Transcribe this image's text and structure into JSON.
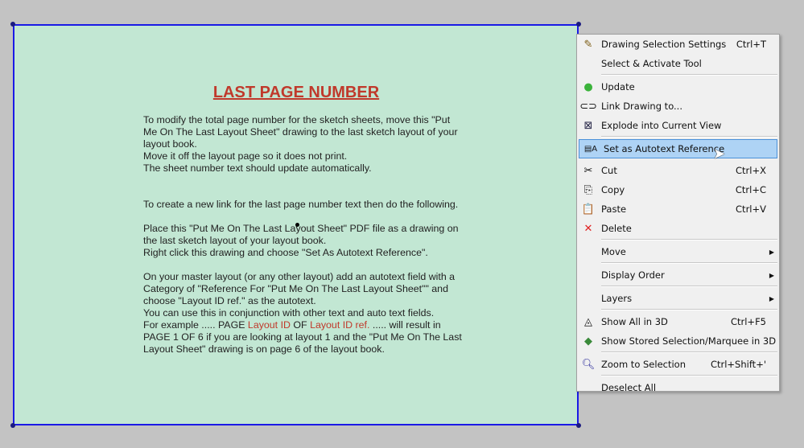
{
  "document": {
    "title": "LAST PAGE NUMBER",
    "paragraphs": [
      "To modify the total page number for the sketch sheets, move this \"Put Me On The Last Layout Sheet\" drawing to the last sketch layout of your layout book.\nMove it off the layout page so it does not print.\nThe sheet number text should update automatically.",
      "To create a new link for the last page number text then do the following.",
      "Place this \"Put Me On The Last Layout Sheet\" PDF file as a drawing on the last sketch layout of your layout book.\nRight click this drawing and choose \"Set As Autotext Reference\".",
      "On your master layout (or any other layout) add an autotext field with a Category of \"Reference For \"Put Me On The Last Layout Sheet\"\" and choose \"Layout ID ref.\" as the autotext.\nYou can use this in conjunction with other text and auto text fields."
    ],
    "example_parts": [
      "For example ..... PAGE ",
      "Layout ID",
      " OF ",
      "Layout ID ref.",
      " ..... will result in PAGE 1 OF 6 if you are looking at layout 1 and the \"Put Me On The Last Layout Sheet\" drawing is on page 6 of the layout book."
    ]
  },
  "context_menu": {
    "items": [
      {
        "label": "Drawing Selection Settings",
        "shortcut": "Ctrl+T",
        "icon": "drawing-settings-icon"
      },
      {
        "label": "Select & Activate Tool",
        "shortcut": ""
      },
      {
        "label": "Update",
        "shortcut": "",
        "icon": "update-icon"
      },
      {
        "label": "Link Drawing to...",
        "shortcut": "",
        "icon": "link-icon"
      },
      {
        "label": "Explode into Current View",
        "shortcut": "",
        "icon": "explode-icon"
      },
      {
        "label": "Set as Autotext Reference",
        "shortcut": "",
        "icon": "autotext-icon"
      },
      {
        "label": "Cut",
        "shortcut": "Ctrl+X",
        "icon": "scissors-icon"
      },
      {
        "label": "Copy",
        "shortcut": "Ctrl+C",
        "icon": "copy-icon"
      },
      {
        "label": "Paste",
        "shortcut": "Ctrl+V",
        "icon": "paste-icon"
      },
      {
        "label": "Delete",
        "shortcut": "",
        "icon": "delete-icon"
      },
      {
        "label": "Move",
        "shortcut": ""
      },
      {
        "label": "Display Order",
        "shortcut": ""
      },
      {
        "label": "Layers",
        "shortcut": ""
      },
      {
        "label": "Show All in 3D",
        "shortcut": "Ctrl+F5",
        "icon": "show-3d-icon"
      },
      {
        "label": "Show Stored Selection/Marquee in 3D",
        "shortcut": "",
        "icon": "show-stored-3d-icon"
      },
      {
        "label": "Zoom to Selection",
        "shortcut": "Ctrl+Shift+'",
        "icon": "zoom-icon"
      },
      {
        "label": "Deselect All",
        "shortcut": ""
      }
    ]
  }
}
